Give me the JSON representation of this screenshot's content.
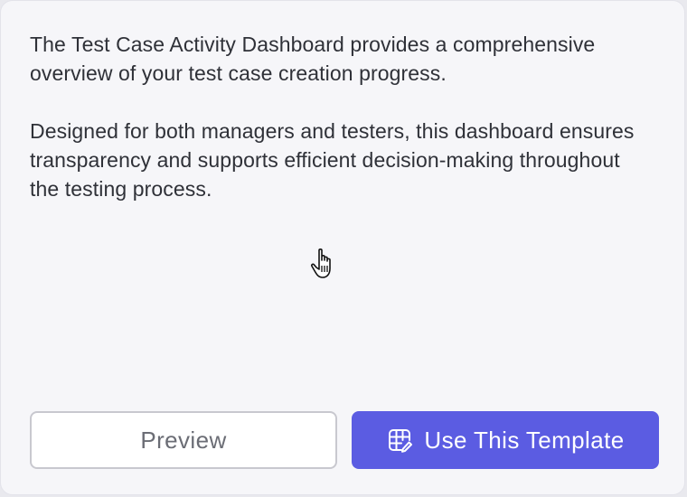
{
  "description": {
    "paragraph_1": "The Test Case Activity Dashboard provides a comprehensive overview of your test case creation progress.",
    "paragraph_2": "Designed for both managers and testers, this dashboard ensures transparency and supports efficient decision-making throughout the testing process."
  },
  "actions": {
    "preview_label": "Preview",
    "use_template_label": "Use This Template",
    "use_template_icon": "grid-edit-icon"
  },
  "colors": {
    "accent": "#5b5ce2",
    "card_background": "#f6f6f9",
    "text": "#2f3138"
  }
}
